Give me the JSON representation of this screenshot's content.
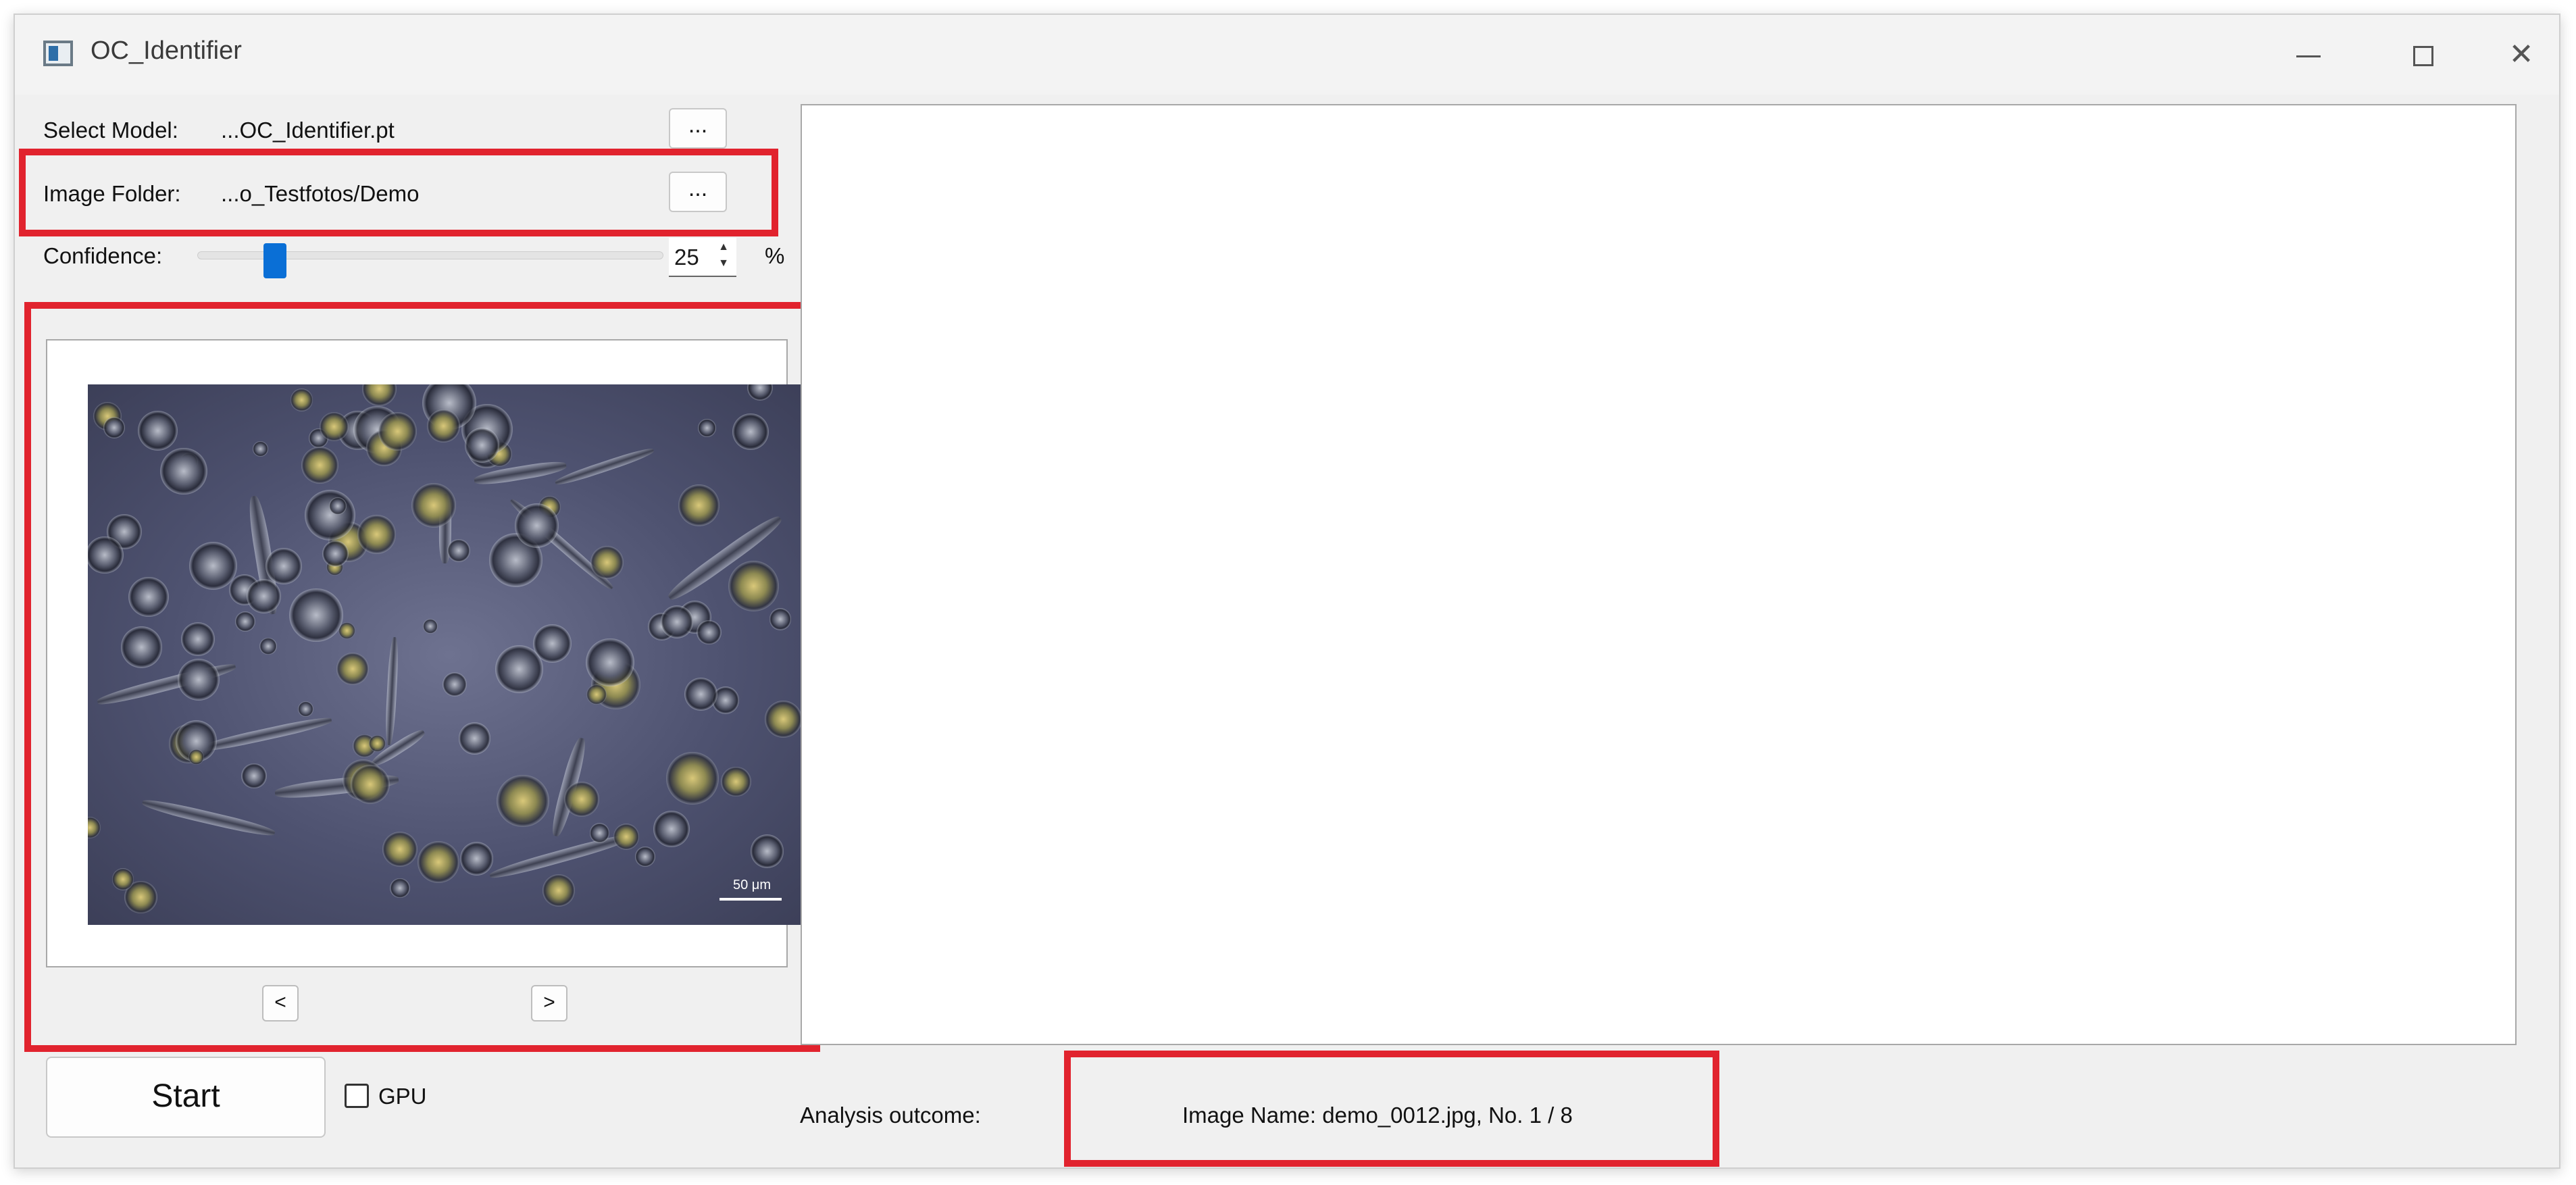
{
  "window": {
    "title": "OC_Identifier"
  },
  "controls": {
    "model_label": "Select Model:",
    "model_value": "...OC_Identifier.pt",
    "model_browse": "...",
    "folder_label": "Image Folder:",
    "folder_value": "...o_Testfotos/Demo",
    "folder_browse": "...",
    "confidence_label": "Confidence:",
    "confidence_value": "25",
    "confidence_unit": "%",
    "confidence_slider_fraction": 0.25
  },
  "preview": {
    "prev_label": "<",
    "next_label": ">",
    "scale_bar_text": "50 μm"
  },
  "footer": {
    "start_label": "Start",
    "gpu_label": "GPU",
    "gpu_checked": false,
    "outcome_label": "Analysis outcome:",
    "image_info": "Image Name:  demo_0012.jpg,  No. 1 / 8"
  },
  "colors": {
    "highlight": "#e1232e",
    "slider_handle": "#0a6fd6"
  }
}
